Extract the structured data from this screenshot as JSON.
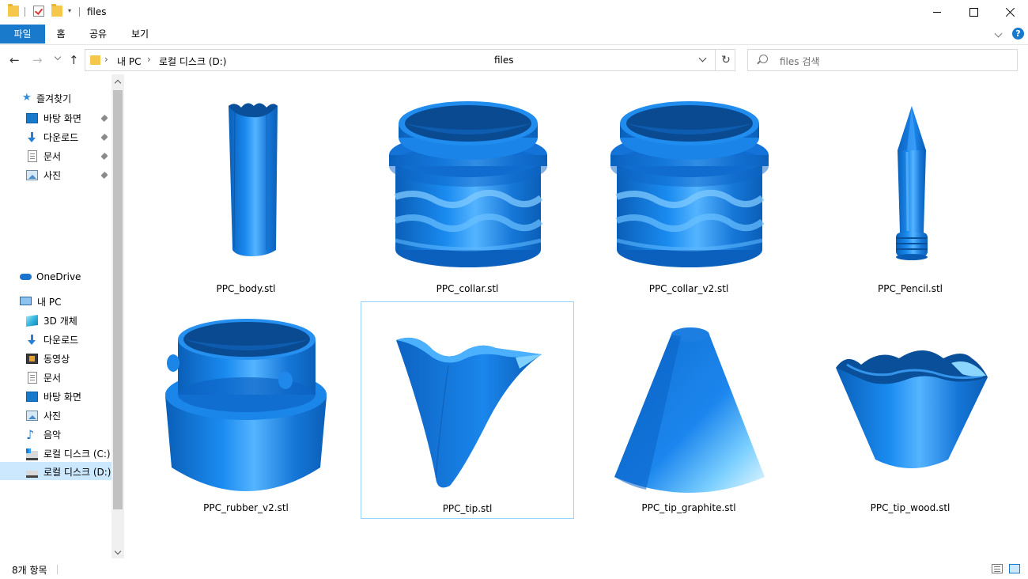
{
  "window": {
    "title": "files"
  },
  "ribbon": {
    "tabs": [
      "파일",
      "홈",
      "공유",
      "보기"
    ],
    "help_label": "?"
  },
  "navigation": {
    "back": "←",
    "forward": "→",
    "up": "↑",
    "breadcrumb": [
      "내 PC",
      "로컬 디스크 (D:)"
    ],
    "breadcrumb_sep": "›",
    "current_folder": "files",
    "refresh": "↻",
    "search_placeholder": "files 검색"
  },
  "sidebar": {
    "quick_access_label": "즐겨찾기",
    "quick_access": [
      {
        "label": "바탕 화면",
        "icon": "desktop-icon"
      },
      {
        "label": "다운로드",
        "icon": "download-icon"
      },
      {
        "label": "문서",
        "icon": "document-icon"
      },
      {
        "label": "사진",
        "icon": "pictures-icon"
      }
    ],
    "onedrive_label": "OneDrive",
    "this_pc_label": "내 PC",
    "this_pc": [
      {
        "label": "3D 개체",
        "icon": "3d-objects-icon"
      },
      {
        "label": "다운로드",
        "icon": "download-icon"
      },
      {
        "label": "동영상",
        "icon": "videos-icon"
      },
      {
        "label": "문서",
        "icon": "document-icon"
      },
      {
        "label": "바탕 화면",
        "icon": "desktop-icon"
      },
      {
        "label": "사진",
        "icon": "pictures-icon"
      },
      {
        "label": "음악",
        "icon": "music-icon"
      },
      {
        "label": "로컬 디스크 (C:)",
        "icon": "drive-c-icon"
      },
      {
        "label": "로컬 디스크 (D:)",
        "icon": "drive-d-icon"
      }
    ]
  },
  "files": [
    {
      "name": "PPC_body.stl",
      "shape": "body"
    },
    {
      "name": "PPC_collar.stl",
      "shape": "collar"
    },
    {
      "name": "PPC_collar_v2.stl",
      "shape": "collar"
    },
    {
      "name": "PPC_Pencil.stl",
      "shape": "pencil"
    },
    {
      "name": "PPC_rubber_v2.stl",
      "shape": "rubber"
    },
    {
      "name": "PPC_tip.stl",
      "shape": "tip"
    },
    {
      "name": "PPC_tip_graphite.stl",
      "shape": "cone"
    },
    {
      "name": "PPC_tip_wood.stl",
      "shape": "wood"
    }
  ],
  "selected_file": "PPC_tip.stl",
  "status": {
    "item_count": "8개 항목"
  },
  "colors": {
    "accent": "#1979ca",
    "selection": "#cce8ff",
    "model_blue": "#1a7ee0"
  }
}
